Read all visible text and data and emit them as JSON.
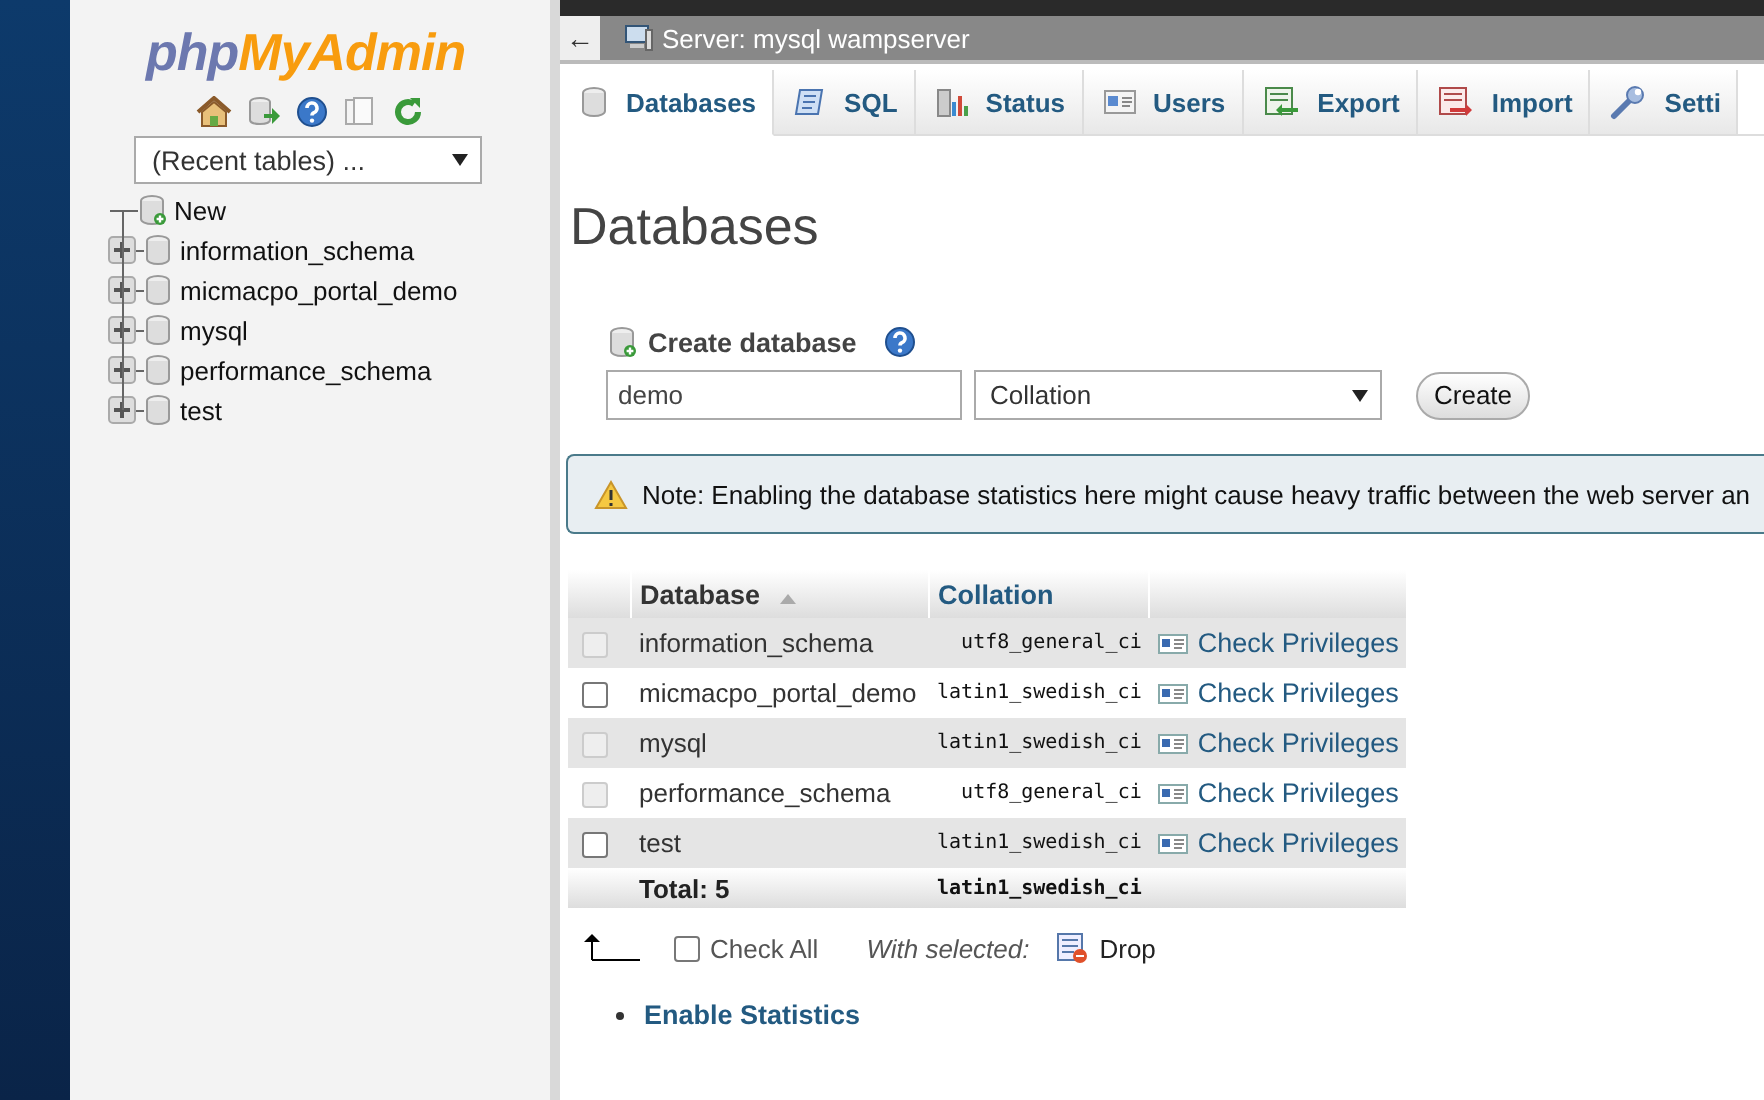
{
  "sidebar": {
    "logo": {
      "php": "php",
      "myadmin": "MyAdmin"
    },
    "recent_tables": {
      "value": "(Recent tables) ..."
    },
    "tree": [
      {
        "label": "New",
        "kind": "new"
      },
      {
        "label": "information_schema",
        "kind": "database",
        "expanded": false
      },
      {
        "label": "micmacpo_portal_demo",
        "kind": "database",
        "expanded": false
      },
      {
        "label": "mysql",
        "kind": "database",
        "expanded": false
      },
      {
        "label": "performance_schema",
        "kind": "database",
        "expanded": false
      },
      {
        "label": "test",
        "kind": "database",
        "expanded": false
      }
    ]
  },
  "breadcrumb": {
    "back": "←",
    "server": "Server: mysql wampserver"
  },
  "tabs": [
    {
      "label": "Databases",
      "selected": true
    },
    {
      "label": "SQL",
      "selected": false
    },
    {
      "label": "Status",
      "selected": false
    },
    {
      "label": "Users",
      "selected": false
    },
    {
      "label": "Export",
      "selected": false
    },
    {
      "label": "Import",
      "selected": false
    },
    {
      "label": "Setti",
      "selected": false
    }
  ],
  "page_title": "Databases",
  "create_database": {
    "label": "Create database",
    "name_value": "demo",
    "collation_select": {
      "value": "Collation"
    },
    "button": "Create"
  },
  "note": "Note: Enabling the database statistics here might cause heavy traffic between the web server an",
  "databases_table": {
    "columns": [
      {
        "label": "Database",
        "sorted": true
      },
      {
        "label": "Collation",
        "sorted": false
      }
    ],
    "rows": [
      {
        "name": "information_schema",
        "collation": "utf8_general_ci",
        "action": "Check Privileges",
        "disabled": true,
        "checked": false
      },
      {
        "name": "micmacpo_portal_demo",
        "collation": "latin1_swedish_ci",
        "action": "Check Privileges",
        "disabled": false,
        "checked": false
      },
      {
        "name": "mysql",
        "collation": "latin1_swedish_ci",
        "action": "Check Privileges",
        "disabled": true,
        "checked": false
      },
      {
        "name": "performance_schema",
        "collation": "utf8_general_ci",
        "action": "Check Privileges",
        "disabled": true,
        "checked": false
      },
      {
        "name": "test",
        "collation": "latin1_swedish_ci",
        "action": "Check Privileges",
        "disabled": false,
        "checked": false
      }
    ],
    "footer": {
      "label": "Total: 5",
      "collation": "latin1_swedish_ci"
    }
  },
  "bulk_actions": {
    "check_all": "Check All",
    "checked": false,
    "with_selected": "With selected:",
    "drop": "Drop"
  },
  "links": [
    "Enable Statistics"
  ]
}
